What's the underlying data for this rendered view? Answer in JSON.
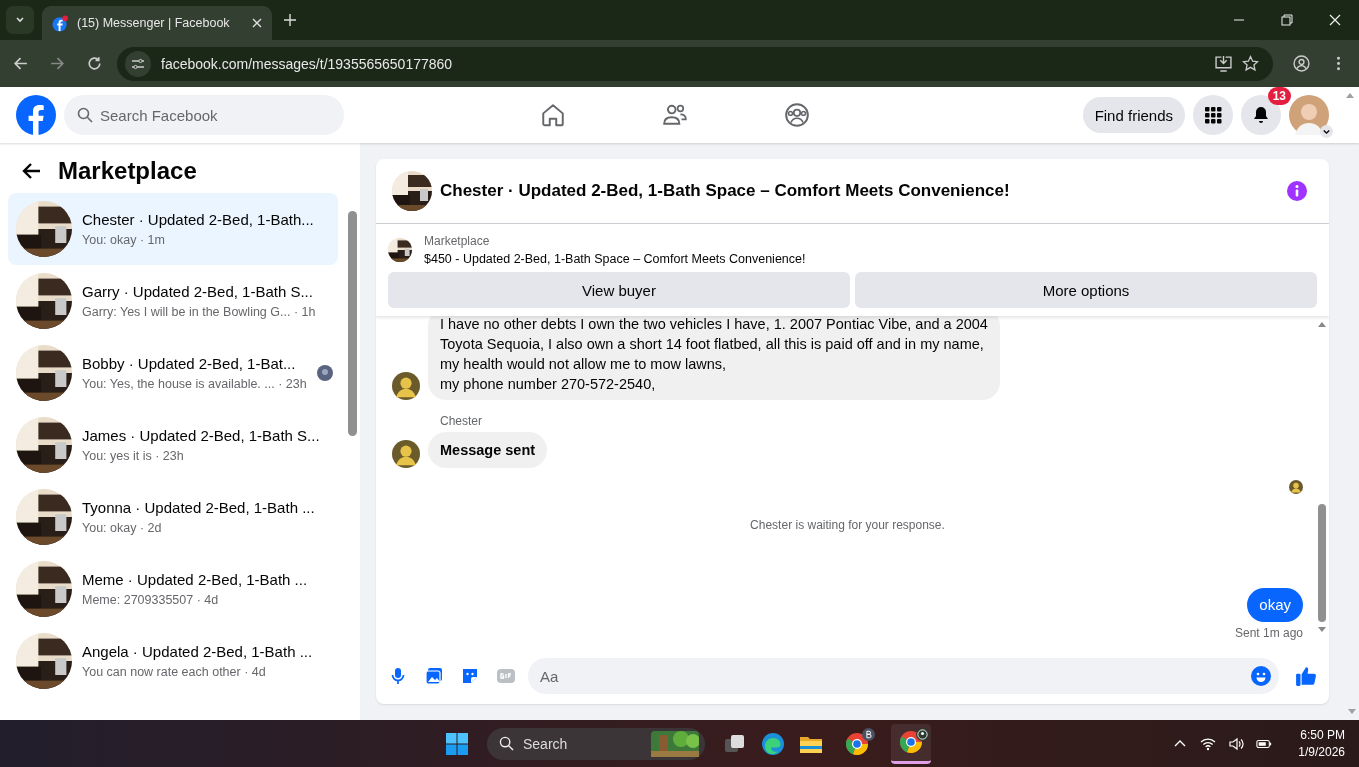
{
  "browser": {
    "tab_title": "(15) Messenger | Facebook",
    "tab_badge": true,
    "url": "facebook.com/messages/t/1935565650177860"
  },
  "header": {
    "search_placeholder": "Search Facebook",
    "find_friends": "Find friends",
    "notifications": "13"
  },
  "sidebar": {
    "title": "Marketplace",
    "chats": [
      {
        "title": "Chester · Updated 2-Bed, 1-Bath...",
        "preview": "You: okay · 1m",
        "selected": true,
        "seen": false
      },
      {
        "title": "Garry · Updated 2-Bed, 1-Bath S...",
        "preview": "Garry: Yes I will be in the Bowling G... · 1h",
        "selected": false,
        "seen": false
      },
      {
        "title": "Bobby · Updated 2-Bed, 1-Bat...",
        "preview": "You: Yes, the house is available. ... · 23h",
        "selected": false,
        "seen": true
      },
      {
        "title": "James · Updated 2-Bed, 1-Bath S...",
        "preview": "You: yes it is · 23h",
        "selected": false,
        "seen": false
      },
      {
        "title": "Tyonna · Updated 2-Bed, 1-Bath ...",
        "preview": "You: okay · 2d",
        "selected": false,
        "seen": false
      },
      {
        "title": "Meme · Updated 2-Bed, 1-Bath ...",
        "preview": "Meme: 2709335507 · 4d",
        "selected": false,
        "seen": false
      },
      {
        "title": "Angela · Updated 2-Bed, 1-Bath ...",
        "preview": "You can now rate each other · 4d",
        "selected": false,
        "seen": false
      }
    ]
  },
  "conversation": {
    "title": "Chester · Updated 2-Bed, 1-Bath Space – Comfort Meets Convenience!",
    "listing": {
      "label": "Marketplace",
      "text": "$450 - Updated 2-Bed, 1-Bath Space – Comfort Meets Convenience!"
    },
    "buttons": [
      "View buyer",
      "More options"
    ],
    "messages": [
      {
        "kind": "incoming",
        "bold": false,
        "lines": [
          "I have no other debts I own the two vehicles I have, 1. 2007 Pontiac Vibe, and a 2004",
          "Toyota Sequoia, I also own a short 14 foot flatbed, all this is paid off and in my name,",
          "my health would not allow me to mow lawns,",
          "my phone number 270-572-2540,"
        ]
      },
      {
        "kind": "sender",
        "text": "Chester"
      },
      {
        "kind": "incoming",
        "bold": true,
        "lines": [
          "Message sent"
        ]
      },
      {
        "kind": "seen"
      },
      {
        "kind": "notice",
        "text": "Chester is waiting for your response."
      },
      {
        "kind": "outgoing",
        "text": "okay",
        "status": "Sent 1m ago"
      }
    ],
    "composer_placeholder": "Aa"
  },
  "taskbar": {
    "search_placeholder": "Search",
    "time": "6:50 PM",
    "date": "1/9/2026"
  }
}
